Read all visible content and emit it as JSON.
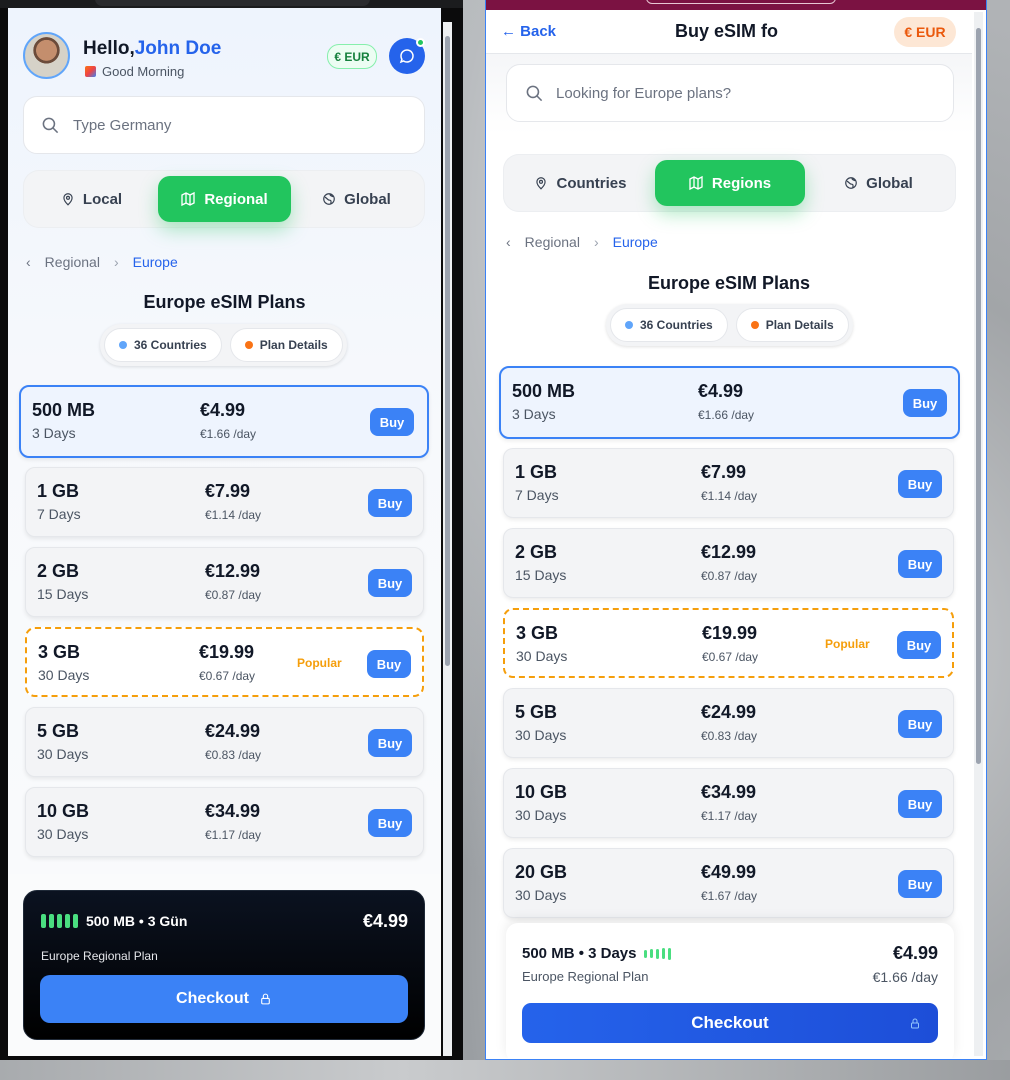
{
  "left": {
    "greeting_prefix": "Hello,",
    "user_name": "John Doe",
    "subtitle": "Good Morning",
    "currency": "€ EUR",
    "search_placeholder": "Type Germany",
    "tabs": [
      "Local",
      "Regional",
      "Global"
    ],
    "active_tab": "Regional",
    "breadcrumb": [
      "Regional",
      "Europe"
    ],
    "title": "Europe eSIM Plans",
    "chips": [
      "36 Countries",
      "Plan Details"
    ],
    "plans": [
      {
        "size": "500 MB",
        "days": "3 Days",
        "price": "€4.99",
        "per_day": "€1.66 /day",
        "buy": "Buy"
      },
      {
        "size": "1 GB",
        "days": "7 Days",
        "price": "€7.99",
        "per_day": "€1.14 /day",
        "buy": "Buy"
      },
      {
        "size": "2 GB",
        "days": "15 Days",
        "price": "€12.99",
        "per_day": "€0.87 /day",
        "buy": "Buy"
      },
      {
        "size": "3 GB",
        "days": "30 Days",
        "price": "€19.99",
        "per_day": "€0.67 /day",
        "buy": "Buy",
        "popular": "Popular"
      },
      {
        "size": "5 GB",
        "days": "30 Days",
        "price": "€24.99",
        "per_day": "€0.83 /day",
        "buy": "Buy"
      },
      {
        "size": "10 GB",
        "days": "30 Days",
        "price": "€34.99",
        "per_day": "€1.17 /day",
        "buy": "Buy"
      }
    ],
    "checkout": {
      "summary": "500 MB • 3 Gün",
      "price": "€4.99",
      "plan_name": "Europe Regional Plan",
      "button": "Checkout"
    }
  },
  "right": {
    "back": "← Back",
    "header_title": "Buy eSIM fo",
    "currency": "€ EUR",
    "search_placeholder": "Looking for Europe plans?",
    "tabs": [
      "Countries",
      "Regions",
      "Global"
    ],
    "active_tab": "Regions",
    "breadcrumb": [
      "Regional",
      "Europe"
    ],
    "title": "Europe eSIM Plans",
    "chips": [
      "36 Countries",
      "Plan Details"
    ],
    "plans": [
      {
        "size": "500 MB",
        "days": "3 Days",
        "price": "€4.99",
        "per_day": "€1.66 /day",
        "buy": "Buy"
      },
      {
        "size": "1 GB",
        "days": "7 Days",
        "price": "€7.99",
        "per_day": "€1.14 /day",
        "buy": "Buy"
      },
      {
        "size": "2 GB",
        "days": "15 Days",
        "price": "€12.99",
        "per_day": "€0.87 /day",
        "buy": "Buy"
      },
      {
        "size": "3 GB",
        "days": "30 Days",
        "price": "€19.99",
        "per_day": "€0.67 /day",
        "buy": "Buy",
        "popular": "Popular"
      },
      {
        "size": "5 GB",
        "days": "30 Days",
        "price": "€24.99",
        "per_day": "€0.83 /day",
        "buy": "Buy"
      },
      {
        "size": "10 GB",
        "days": "30 Days",
        "price": "€34.99",
        "per_day": "€1.17 /day",
        "buy": "Buy"
      },
      {
        "size": "20 GB",
        "days": "30 Days",
        "price": "€49.99",
        "per_day": "€1.67 /day",
        "buy": "Buy"
      }
    ],
    "checkout": {
      "summary": "500 MB • 3 Days",
      "price": "€4.99",
      "plan_name": "Europe Regional Plan",
      "per_day": "€1.66 /day",
      "button": "Checkout"
    }
  },
  "colors": {
    "accent": "#3b82f6",
    "green": "#22c55e",
    "popular": "#f59e0b",
    "brand_bar": "#7b1242"
  }
}
